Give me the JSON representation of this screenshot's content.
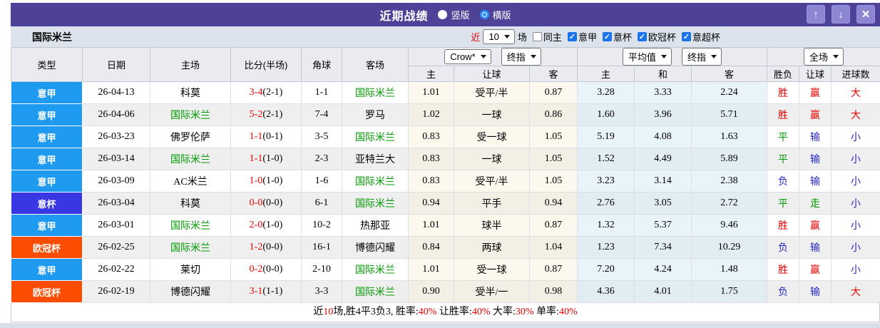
{
  "colors": {
    "header_purple": "#4e4298",
    "button_purple": "#8d86d3",
    "filter_bar": "#dde3ed",
    "checkbox_blue": "#1a73e8",
    "league": {
      "意甲": "#1e9bf0",
      "意杯": "#3837e3",
      "欧冠杯": "#fc4c02"
    },
    "text": {
      "red": "#e60000",
      "green": "#009900",
      "blue": "#2626cc",
      "black": "#000000"
    }
  },
  "titlebar": {
    "title": "近期战绩",
    "radios": [
      {
        "label": "竖版",
        "checked": false
      },
      {
        "label": "横版",
        "checked": true
      }
    ],
    "buttons": {
      "up": "↑",
      "down": "↓",
      "close": "✕"
    }
  },
  "filterbar": {
    "team": "国际米兰",
    "recent_label": "近",
    "recent_value": "10",
    "games_label": "场",
    "same_home": {
      "label": "同主",
      "checked": false
    },
    "leagues": [
      {
        "label": "意甲",
        "checked": true
      },
      {
        "label": "意杯",
        "checked": true
      },
      {
        "label": "欧冠杯",
        "checked": true
      },
      {
        "label": "意超杯",
        "checked": true
      }
    ]
  },
  "table": {
    "static_headers": [
      "类型",
      "日期",
      "主场",
      "比分(半场)",
      "角球",
      "客场"
    ],
    "groups": [
      {
        "selects": [
          "Crow*",
          "终指"
        ],
        "cols": [
          "主",
          "让球",
          "客"
        ]
      },
      {
        "selects": [
          "平均值",
          "终指"
        ],
        "cols": [
          "主",
          "和",
          "客"
        ]
      },
      {
        "selects": [
          "全场"
        ],
        "cols": [
          "胜负",
          "让球",
          "进球数"
        ]
      }
    ],
    "rows": [
      {
        "league": "意甲",
        "date": "26-04-13",
        "home": "科莫",
        "home_color": "black",
        "score": "3-4",
        "half": "(2-1)",
        "corner": "1-1",
        "away": "国际米兰",
        "away_color": "green",
        "crow_home": "1.01",
        "handicap": "受平/半",
        "crow_away": "0.87",
        "avg_home": "3.28",
        "avg_draw": "3.33",
        "avg_away": "2.24",
        "result": {
          "t": "胜",
          "c": "red"
        },
        "let_result": {
          "t": "赢",
          "c": "red"
        },
        "goals": {
          "t": "大",
          "c": "red"
        }
      },
      {
        "league": "意甲",
        "date": "26-04-06",
        "home": "国际米兰",
        "home_color": "green",
        "score": "5-2",
        "half": "(2-1)",
        "corner": "7-4",
        "away": "罗马",
        "away_color": "black",
        "crow_home": "1.02",
        "handicap": "一球",
        "crow_away": "0.86",
        "avg_home": "1.60",
        "avg_draw": "3.96",
        "avg_away": "5.71",
        "result": {
          "t": "胜",
          "c": "red"
        },
        "let_result": {
          "t": "赢",
          "c": "red"
        },
        "goals": {
          "t": "大",
          "c": "red"
        }
      },
      {
        "league": "意甲",
        "date": "26-03-23",
        "home": "佛罗伦萨",
        "home_color": "black",
        "score": "1-1",
        "half": "(0-1)",
        "corner": "3-5",
        "away": "国际米兰",
        "away_color": "green",
        "crow_home": "0.83",
        "handicap": "受一球",
        "crow_away": "1.05",
        "avg_home": "5.19",
        "avg_draw": "4.08",
        "avg_away": "1.63",
        "result": {
          "t": "平",
          "c": "green"
        },
        "let_result": {
          "t": "输",
          "c": "blue"
        },
        "goals": {
          "t": "小",
          "c": "blue"
        }
      },
      {
        "league": "意甲",
        "date": "26-03-14",
        "home": "国际米兰",
        "home_color": "green",
        "score": "1-1",
        "half": "(1-0)",
        "corner": "2-3",
        "away": "亚特兰大",
        "away_color": "black",
        "crow_home": "0.83",
        "handicap": "一球",
        "crow_away": "1.05",
        "avg_home": "1.52",
        "avg_draw": "4.49",
        "avg_away": "5.89",
        "result": {
          "t": "平",
          "c": "green"
        },
        "let_result": {
          "t": "输",
          "c": "blue"
        },
        "goals": {
          "t": "小",
          "c": "blue"
        }
      },
      {
        "league": "意甲",
        "date": "26-03-09",
        "home": "AC米兰",
        "home_color": "black",
        "score": "1-0",
        "half": "(1-0)",
        "corner": "1-6",
        "away": "国际米兰",
        "away_color": "green",
        "crow_home": "0.83",
        "handicap": "受平/半",
        "crow_away": "1.05",
        "avg_home": "3.23",
        "avg_draw": "3.14",
        "avg_away": "2.38",
        "result": {
          "t": "负",
          "c": "blue"
        },
        "let_result": {
          "t": "输",
          "c": "blue"
        },
        "goals": {
          "t": "小",
          "c": "blue"
        }
      },
      {
        "league": "意杯",
        "date": "26-03-04",
        "home": "科莫",
        "home_color": "black",
        "score": "0-0",
        "half": "(0-0)",
        "corner": "6-1",
        "away": "国际米兰",
        "away_color": "green",
        "crow_home": "0.94",
        "handicap": "平手",
        "crow_away": "0.94",
        "avg_home": "2.76",
        "avg_draw": "3.05",
        "avg_away": "2.72",
        "result": {
          "t": "平",
          "c": "green"
        },
        "let_result": {
          "t": "走",
          "c": "green"
        },
        "goals": {
          "t": "小",
          "c": "blue"
        }
      },
      {
        "league": "意甲",
        "date": "26-03-01",
        "home": "国际米兰",
        "home_color": "green",
        "score": "2-0",
        "half": "(1-0)",
        "corner": "10-2",
        "away": "热那亚",
        "away_color": "black",
        "crow_home": "1.01",
        "handicap": "球半",
        "crow_away": "0.87",
        "avg_home": "1.32",
        "avg_draw": "5.37",
        "avg_away": "9.46",
        "result": {
          "t": "胜",
          "c": "red"
        },
        "let_result": {
          "t": "赢",
          "c": "red"
        },
        "goals": {
          "t": "小",
          "c": "blue"
        }
      },
      {
        "league": "欧冠杯",
        "date": "26-02-25",
        "home": "国际米兰",
        "home_color": "green",
        "score": "1-2",
        "half": "(0-0)",
        "corner": "16-1",
        "away": "博德闪耀",
        "away_color": "black",
        "crow_home": "0.84",
        "handicap": "两球",
        "crow_away": "1.04",
        "avg_home": "1.23",
        "avg_draw": "7.34",
        "avg_away": "10.29",
        "result": {
          "t": "负",
          "c": "blue"
        },
        "let_result": {
          "t": "输",
          "c": "blue"
        },
        "goals": {
          "t": "小",
          "c": "blue"
        }
      },
      {
        "league": "意甲",
        "date": "26-02-22",
        "home": "莱切",
        "home_color": "black",
        "score": "0-2",
        "half": "(0-0)",
        "corner": "2-10",
        "away": "国际米兰",
        "away_color": "green",
        "crow_home": "1.01",
        "handicap": "受一球",
        "crow_away": "0.87",
        "avg_home": "7.20",
        "avg_draw": "4.24",
        "avg_away": "1.48",
        "result": {
          "t": "胜",
          "c": "red"
        },
        "let_result": {
          "t": "赢",
          "c": "red"
        },
        "goals": {
          "t": "小",
          "c": "blue"
        }
      },
      {
        "league": "欧冠杯",
        "date": "26-02-19",
        "home": "博德闪耀",
        "home_color": "black",
        "score": "3-1",
        "half": "(1-1)",
        "corner": "3-3",
        "away": "国际米兰",
        "away_color": "green",
        "crow_home": "0.90",
        "handicap": "受半/一",
        "crow_away": "0.98",
        "avg_home": "4.36",
        "avg_draw": "4.01",
        "avg_away": "1.75",
        "result": {
          "t": "负",
          "c": "blue"
        },
        "let_result": {
          "t": "输",
          "c": "blue"
        },
        "goals": {
          "t": "大",
          "c": "red"
        }
      }
    ]
  },
  "summary": {
    "segments": [
      {
        "t": "近",
        "c": "black"
      },
      {
        "t": "10",
        "c": "red"
      },
      {
        "t": "场,胜4平3负3, 胜率:",
        "c": "black"
      },
      {
        "t": "40%",
        "c": "red"
      },
      {
        "t": " 让胜率:",
        "c": "black"
      },
      {
        "t": "40%",
        "c": "red"
      },
      {
        "t": " 大率:",
        "c": "black"
      },
      {
        "t": "30%",
        "c": "red"
      },
      {
        "t": " 单率:",
        "c": "black"
      },
      {
        "t": "40%",
        "c": "red"
      }
    ]
  }
}
